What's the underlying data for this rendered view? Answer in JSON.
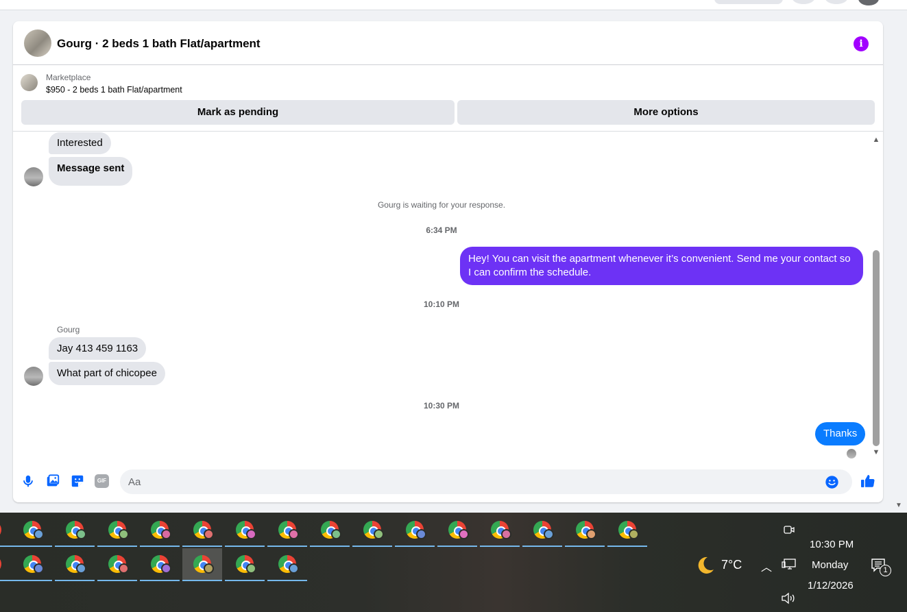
{
  "conversation": {
    "title": "Gourg · 2 beds 1 bath Flat/apartment"
  },
  "marketplace": {
    "label": "Marketplace",
    "listing": "$950 - 2 beds 1 bath Flat/apartment",
    "mark_pending": "Mark as pending",
    "more_options": "More options"
  },
  "messages": {
    "interested": "Interested",
    "message_sent": "Message sent",
    "waiting_note": "Gourg is waiting for your response.",
    "ts1": "6:34 PM",
    "reply1": "Hey! You can visit the apartment whenever it’s convenient. Send me your contact so I can confirm the schedule.",
    "ts2": "10:10 PM",
    "sender_name": "Gourg",
    "incoming1": "Jay 413 459 1163",
    "incoming2": "What part of chicopee",
    "ts3": "10:30 PM",
    "reply2": "Thanks"
  },
  "composer": {
    "placeholder": "Aa",
    "icons": [
      "microphone-icon",
      "photo-icon",
      "sticker-icon",
      "gif-icon",
      "emoji-icon",
      "like-icon"
    ],
    "accent": "#0866ff"
  },
  "taskbar": {
    "weather_temp": "7°C",
    "time": "10:30 PM",
    "day": "Monday",
    "date": "1/12/2026",
    "notification_count": "1",
    "gif_label": "GIF"
  },
  "colors": {
    "outgoing_purple": "#6d32f5",
    "outgoing_blue": "#0a7cff",
    "info_icon": "#a100ff"
  }
}
